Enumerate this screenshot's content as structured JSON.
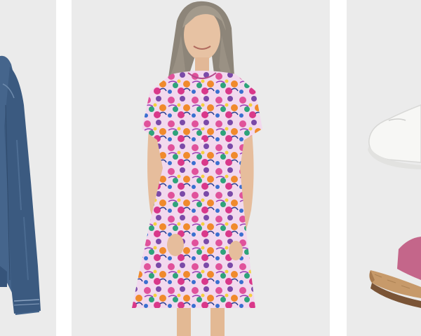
{
  "gallery": {
    "items": [
      {
        "subject": "denim-jacket",
        "background": "#ebebeb"
      },
      {
        "subject": "floral-print-dress-model",
        "background": "#ebebeb"
      },
      {
        "subject": "sneaker-and-cork-sandal",
        "background": "#ebebeb"
      }
    ]
  },
  "colors": {
    "denim": "#3f5f87",
    "dress_pink": "#e0529b",
    "dress_purple": "#7a4aa8",
    "sneaker_white": "#f7f7f5",
    "sandal_pink": "#c4668a",
    "cork": "#c79a6a"
  }
}
